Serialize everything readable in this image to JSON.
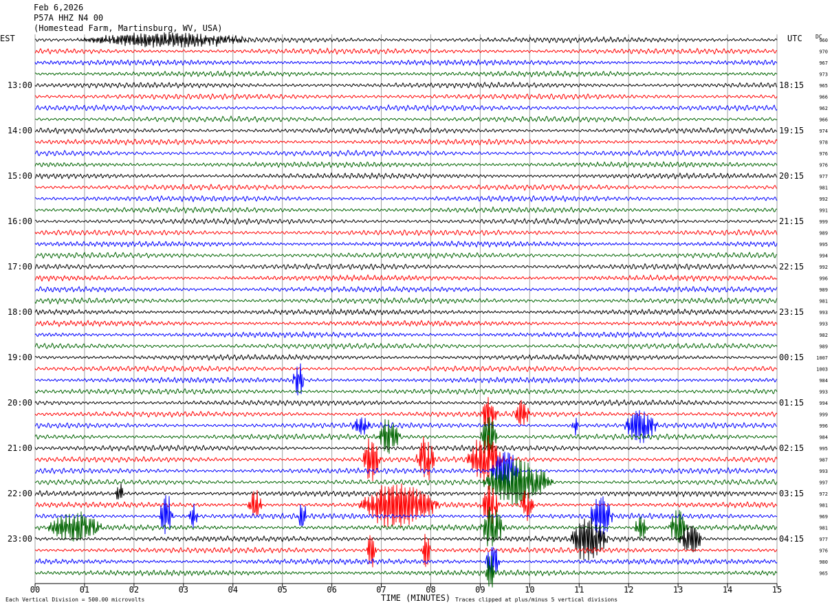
{
  "header": {
    "date": "Feb 6,2026",
    "station": "P57A HHZ N4 00",
    "location": "(Homestead Farm, Martinsburg, WV, USA)"
  },
  "left_zone_label": "EST",
  "right_zone_label": "UTC",
  "dc_header": "DC",
  "footer": {
    "scale_note": "Each Vertical Division =  500.00 microvolts",
    "xlabel": "TIME (MINUTES)",
    "clip_note": "Traces clipped at plus/minus 5 vertical divisions"
  },
  "colors": {
    "trace_cycle": [
      "#000000",
      "#ff0000",
      "#0000ff",
      "#006400"
    ],
    "grid": "#a0a0a0"
  },
  "chart_data": {
    "type": "line",
    "title": "",
    "xlabel": "TIME (MINUTES)",
    "xlim": [
      0,
      15
    ],
    "x_ticks": [
      "00",
      "01",
      "02",
      "03",
      "04",
      "05",
      "06",
      "07",
      "08",
      "09",
      "10",
      "11",
      "12",
      "13",
      "14",
      "15"
    ],
    "trace_count": 48,
    "minutes_per_trace": 15,
    "est_hour_labels": [
      "13:00",
      "14:00",
      "15:00",
      "16:00",
      "17:00",
      "18:00",
      "19:00",
      "20:00",
      "21:00",
      "22:00",
      "23:00"
    ],
    "utc_hour_labels": [
      "18:15",
      "19:15",
      "20:15",
      "21:15",
      "22:15",
      "23:15",
      "00:15",
      "01:15",
      "02:15",
      "03:15",
      "04:15"
    ],
    "dc_offsets": [
      960,
      970,
      967,
      973,
      965,
      966,
      962,
      966,
      974,
      978,
      976,
      976,
      977,
      981,
      992,
      991,
      999,
      989,
      995,
      994,
      992,
      996,
      989,
      981,
      993,
      993,
      982,
      989,
      1007,
      1003,
      984,
      993,
      994,
      999,
      996,
      984,
      995,
      987,
      993,
      997,
      972,
      981,
      969,
      981,
      977,
      976,
      980,
      965
    ],
    "events": [
      {
        "trace": 0,
        "start": 0.8,
        "end": 4.5,
        "amp": 1.4
      },
      {
        "trace": 30,
        "start": 5.2,
        "end": 5.45,
        "amp": 3.5
      },
      {
        "trace": 33,
        "start": 9.0,
        "end": 9.35,
        "amp": 3.5
      },
      {
        "trace": 33,
        "start": 9.7,
        "end": 10.0,
        "amp": 3.2
      },
      {
        "trace": 34,
        "start": 6.4,
        "end": 6.8,
        "amp": 2.0
      },
      {
        "trace": 34,
        "start": 10.85,
        "end": 11.0,
        "amp": 2.0
      },
      {
        "trace": 34,
        "start": 11.9,
        "end": 12.6,
        "amp": 3.5
      },
      {
        "trace": 35,
        "start": 6.9,
        "end": 7.4,
        "amp": 3.5
      },
      {
        "trace": 35,
        "start": 9.0,
        "end": 9.35,
        "amp": 4.5
      },
      {
        "trace": 37,
        "start": 6.6,
        "end": 7.0,
        "amp": 4.5
      },
      {
        "trace": 37,
        "start": 7.7,
        "end": 8.1,
        "amp": 4.5
      },
      {
        "trace": 37,
        "start": 8.7,
        "end": 9.5,
        "amp": 4.5
      },
      {
        "trace": 38,
        "start": 9.2,
        "end": 9.8,
        "amp": 4.5
      },
      {
        "trace": 39,
        "start": 9.0,
        "end": 10.5,
        "amp": 4.5
      },
      {
        "trace": 40,
        "start": 1.6,
        "end": 1.8,
        "amp": 2.0
      },
      {
        "trace": 41,
        "start": 4.3,
        "end": 4.6,
        "amp": 3.0
      },
      {
        "trace": 41,
        "start": 6.5,
        "end": 8.2,
        "amp": 4.5
      },
      {
        "trace": 41,
        "start": 9.0,
        "end": 9.4,
        "amp": 4.5
      },
      {
        "trace": 41,
        "start": 9.8,
        "end": 10.1,
        "amp": 3.0
      },
      {
        "trace": 42,
        "start": 2.5,
        "end": 2.8,
        "amp": 4.5
      },
      {
        "trace": 42,
        "start": 3.1,
        "end": 3.3,
        "amp": 2.5
      },
      {
        "trace": 42,
        "start": 5.3,
        "end": 5.5,
        "amp": 3.0
      },
      {
        "trace": 42,
        "start": 11.2,
        "end": 11.7,
        "amp": 4.5
      },
      {
        "trace": 43,
        "start": 0.2,
        "end": 1.4,
        "amp": 3.0
      },
      {
        "trace": 43,
        "start": 9.0,
        "end": 9.5,
        "amp": 4.5
      },
      {
        "trace": 43,
        "start": 12.1,
        "end": 12.4,
        "amp": 2.5
      },
      {
        "trace": 43,
        "start": 12.8,
        "end": 13.2,
        "amp": 3.5
      },
      {
        "trace": 44,
        "start": 10.8,
        "end": 11.6,
        "amp": 4.5
      },
      {
        "trace": 44,
        "start": 13.0,
        "end": 13.5,
        "amp": 3.0
      },
      {
        "trace": 45,
        "start": 6.7,
        "end": 6.9,
        "amp": 4.0
      },
      {
        "trace": 45,
        "start": 7.8,
        "end": 8.0,
        "amp": 4.0
      },
      {
        "trace": 46,
        "start": 9.1,
        "end": 9.4,
        "amp": 4.0
      },
      {
        "trace": 47,
        "start": 9.1,
        "end": 9.3,
        "amp": 4.0
      }
    ]
  }
}
